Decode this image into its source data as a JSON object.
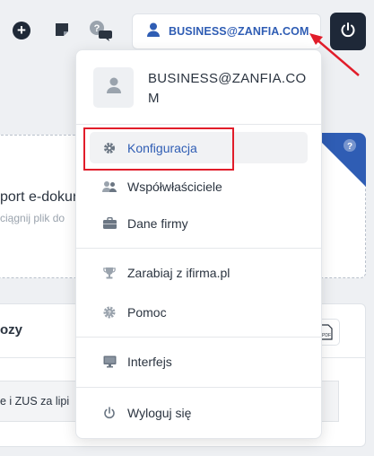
{
  "topbar": {
    "icons": [
      "plus-circle-icon",
      "sticky-note-icon",
      "help-chat-icon"
    ],
    "user_button_label": "BUSINESS@ZANFIA.COM",
    "power_icon": "power-icon"
  },
  "background": {
    "card1_title": "port e-dokun",
    "card1_sub": "ciągnij plik do",
    "card2_title": "ozy",
    "card2_row_text": "e i ZUS za lipi"
  },
  "menu": {
    "email": "BUSINESS@ZANFIA.COM",
    "items": [
      {
        "label": "Konfiguracja",
        "icon": "gear-icon"
      },
      {
        "label": "Współwłaściciele",
        "icon": "users-icon"
      },
      {
        "label": "Dane firmy",
        "icon": "briefcase-icon"
      },
      {
        "label": "Zarabiaj z ifirma.pl",
        "icon": "trophy-icon"
      },
      {
        "label": "Pomoc",
        "icon": "help-gear-icon"
      },
      {
        "label": "Interfejs",
        "icon": "monitor-icon"
      },
      {
        "label": "Wyloguj się",
        "icon": "power-icon"
      }
    ]
  },
  "colors": {
    "accent": "#2f5db4",
    "highlight": "#e11d2a",
    "dark": "#1e2838"
  }
}
